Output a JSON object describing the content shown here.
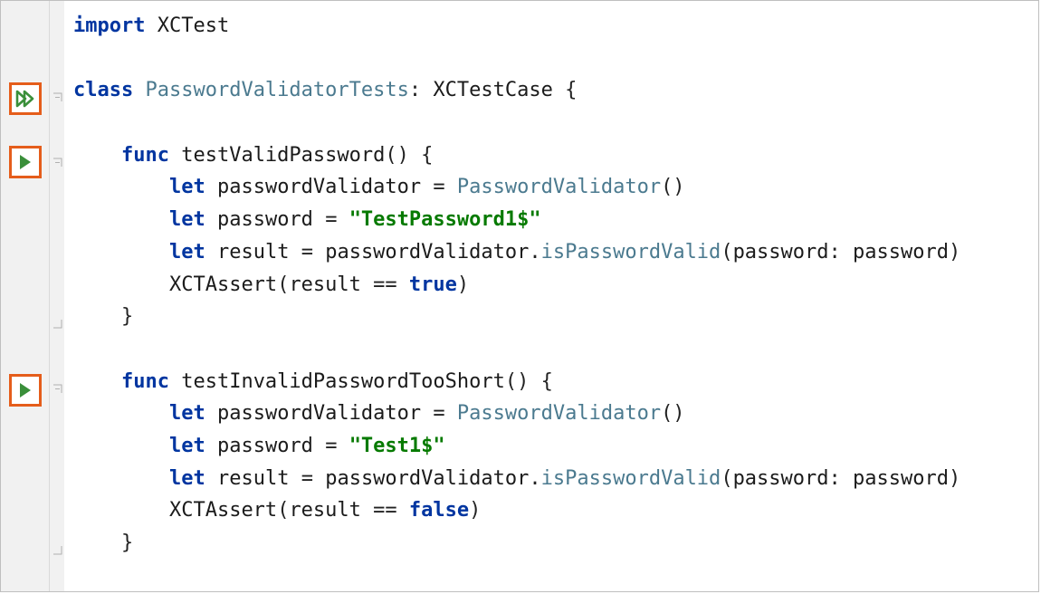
{
  "colors": {
    "keyword": "#0035a0",
    "type": "#4b7a8f",
    "string": "#067a00",
    "run_border": "#e55d1b",
    "run_fill": "#3a8f3a"
  },
  "gutter": {
    "run_all_icon": "double-play-icon",
    "run_icon": "play-icon"
  },
  "code": {
    "l1": {
      "kw": "import",
      "mod": "XCTest"
    },
    "l3": {
      "kw": "class",
      "name": "PasswordValidatorTests",
      "colon": ":",
      "base": "XCTestCase",
      "ob": "{"
    },
    "l5": {
      "kw": "func",
      "name": "testValidPassword",
      "par": "()",
      "ob": "{"
    },
    "l6": {
      "kw": "let",
      "var": "passwordValidator",
      "eq": "=",
      "type": "PasswordValidator",
      "call": "()"
    },
    "l7": {
      "kw": "let",
      "var": "password",
      "eq": "=",
      "str": "\"TestPassword1$\""
    },
    "l8": {
      "kw": "let",
      "var": "result",
      "eq": "=",
      "obj": "passwordValidator",
      "dot": ".",
      "method": "isPasswordValid",
      "open": "(",
      "label": "password",
      "colon": ":",
      "arg": "password",
      "close": ")"
    },
    "l9": {
      "fn": "XCTAssert",
      "open": "(",
      "lhs": "result",
      "op": "==",
      "kw": "true",
      "close": ")"
    },
    "l10": {
      "cb": "}"
    },
    "l12": {
      "kw": "func",
      "name": "testInvalidPasswordTooShort",
      "par": "()",
      "ob": "{"
    },
    "l13": {
      "kw": "let",
      "var": "passwordValidator",
      "eq": "=",
      "type": "PasswordValidator",
      "call": "()"
    },
    "l14": {
      "kw": "let",
      "var": "password",
      "eq": "=",
      "str": "\"Test1$\""
    },
    "l15": {
      "kw": "let",
      "var": "result",
      "eq": "=",
      "obj": "passwordValidator",
      "dot": ".",
      "method": "isPasswordValid",
      "open": "(",
      "label": "password",
      "colon": ":",
      "arg": "password",
      "close": ")"
    },
    "l16": {
      "fn": "XCTAssert",
      "open": "(",
      "lhs": "result",
      "op": "==",
      "kw": "false",
      "close": ")"
    },
    "l17": {
      "cb": "}"
    }
  }
}
